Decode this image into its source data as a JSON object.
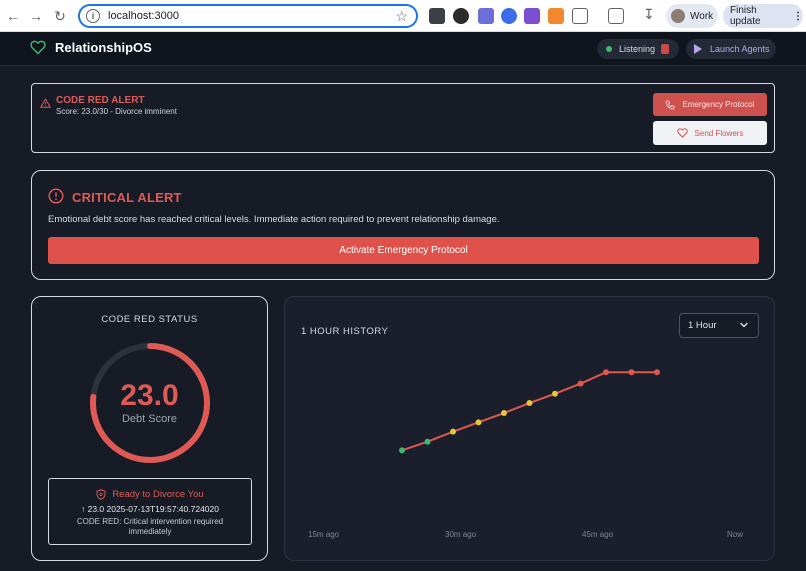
{
  "browser": {
    "url": "localhost:3000",
    "profile": "Work",
    "update_button": "Finish update"
  },
  "app": {
    "name": "RelationshipOS",
    "listening": "Listening",
    "launch": "Launch Agents"
  },
  "code_red": {
    "title": "CODE RED ALERT",
    "subtitle": "Score: 23.0/30 - Divorce imminent",
    "emergency_button": "Emergency Protocol",
    "flowers_button": "Send Flowers"
  },
  "critical": {
    "title": "CRITICAL ALERT",
    "description": "Emotional debt score has reached critical levels. Immediate action required to prevent relationship damage.",
    "button": "Activate Emergency Protocol"
  },
  "status": {
    "heading": "CODE RED STATUS",
    "score": "23.0",
    "score_value": 23.0,
    "score_max": 30,
    "score_label": "Debt Score",
    "state": "Ready to Divorce You",
    "timestamp": "↑ 23.0 2025-07-13T19:57:40.724020",
    "message": "CODE RED: Critical intervention required immediately"
  },
  "history": {
    "heading": "1 HOUR HISTORY",
    "range": "1 Hour",
    "x_labels": [
      "15m ago",
      "30m ago",
      "45m ago",
      "Now"
    ]
  },
  "colors": {
    "accent_red": "#e05a55",
    "green": "#3fb871",
    "yellow": "#e9c53b",
    "line": "#e0584f"
  },
  "chart_data": {
    "type": "line",
    "title": "1 HOUR HISTORY",
    "xlabel": "",
    "ylabel": "",
    "x_ticks": [
      "15m ago",
      "30m ago",
      "45m ago",
      "Now"
    ],
    "series": [
      {
        "values": [
          10.7,
          11.9,
          13.3,
          14.6,
          15.9,
          17.3,
          18.6,
          20.0,
          21.6,
          21.6,
          21.6
        ],
        "point_colors": [
          "green",
          "green",
          "yellow",
          "yellow",
          "yellow",
          "yellow",
          "yellow",
          "red",
          "red",
          "red",
          "red"
        ]
      }
    ],
    "ylim": [
      0,
      30
    ],
    "grid": false,
    "legend": "none"
  }
}
